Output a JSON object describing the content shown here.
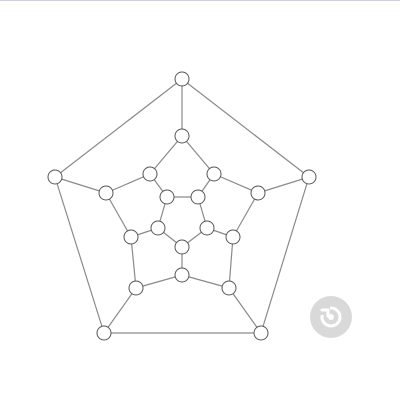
{
  "graph": {
    "name": "dodecahedron",
    "node_count": 20,
    "edge_count": 30,
    "colors": {
      "edge": "#8a8a8a",
      "node_fill": "#ffffff",
      "node_stroke": "#555555"
    }
  },
  "controls": {
    "reset_icon": "rotate-ccw-icon",
    "reset_bg": "#d9d9d9"
  }
}
